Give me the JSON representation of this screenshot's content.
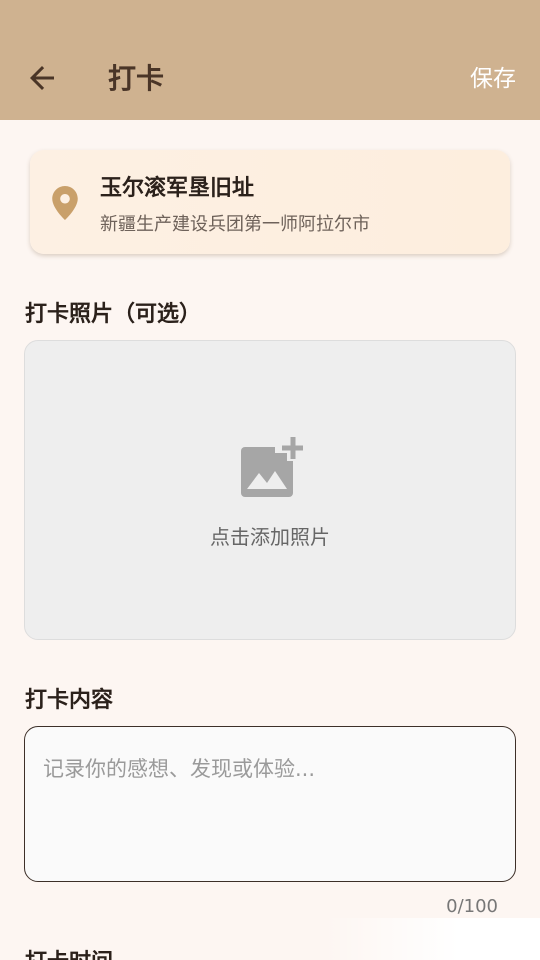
{
  "header": {
    "title": "打卡",
    "save_label": "保存"
  },
  "location": {
    "name": "玉尔滚军垦旧址",
    "address": "新疆生产建设兵团第一师阿拉尔市"
  },
  "photo_section": {
    "label": "打卡照片（可选）",
    "hint": "点击添加照片"
  },
  "content_section": {
    "label": "打卡内容",
    "value": "",
    "placeholder": "记录你的感想、发现或体验...",
    "char_count": "0/100"
  },
  "time_section": {
    "label": "打卡时间"
  },
  "colors": {
    "header_bg": "#cfb290",
    "accent": "#c9a06a",
    "title_text": "#4a3527",
    "page_bg": "#fdf6f2"
  },
  "icons": {
    "back": "arrow-back-icon",
    "location": "location-pin-icon",
    "add_photo": "add-photo-icon"
  }
}
